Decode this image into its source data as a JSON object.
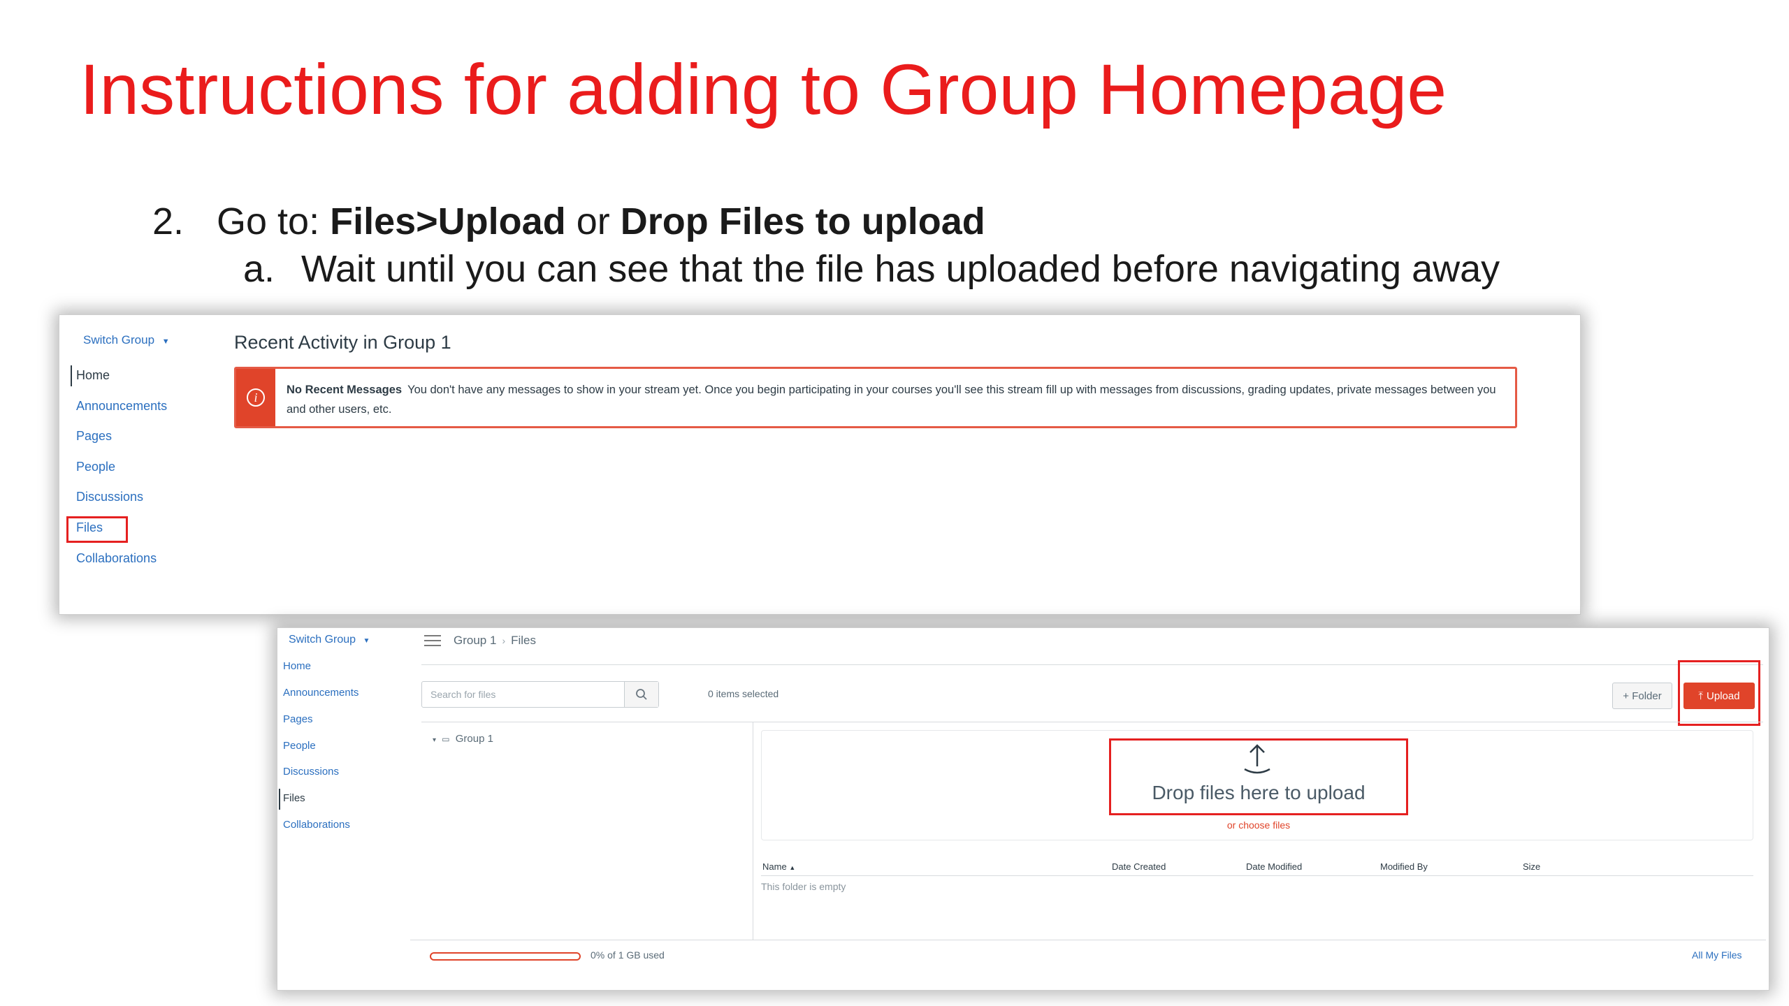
{
  "slide": {
    "title": "Instructions for adding to Group Homepage",
    "step": {
      "number": "2.",
      "prefix": "Go to: ",
      "bold1": "Files>Upload",
      "middle": " or ",
      "bold2": "Drop Files to upload"
    },
    "substep": {
      "number": "a.",
      "text": "Wait until you can see that the file has uploaded before navigating away"
    }
  },
  "screenshot1": {
    "switch_group": "Switch Group",
    "nav": [
      "Home",
      "Announcements",
      "Pages",
      "People",
      "Discussions",
      "Files",
      "Collaborations"
    ],
    "active_nav": "Home",
    "highlighted_nav": "Files",
    "recent_title": "Recent Activity in Group 1",
    "alert": {
      "heading": "No Recent Messages",
      "body": "You don't have any messages to show in your stream yet. Once you begin participating in your courses you'll see this stream fill up with messages from discussions, grading updates, private messages between you and other users, etc."
    }
  },
  "screenshot2": {
    "switch_group": "Switch Group",
    "nav": [
      "Home",
      "Announcements",
      "Pages",
      "People",
      "Discussions",
      "Files",
      "Collaborations"
    ],
    "active_nav": "Files",
    "breadcrumb": [
      "Group 1",
      "Files"
    ],
    "search_placeholder": "Search for files",
    "items_selected": "0 items selected",
    "folder_button": "+ Folder",
    "upload_button": "Upload",
    "tree_root": "Group 1",
    "drop_text": "Drop files here to upload",
    "choose_files": "or choose files",
    "columns": [
      "Name",
      "Date Created",
      "Date Modified",
      "Modified By",
      "Size"
    ],
    "empty_text": "This folder is empty",
    "quota_text": "0% of 1 GB used",
    "quota_fraction": 0,
    "all_files_link": "All My Files"
  },
  "colors": {
    "title_red": "#ea1c1c",
    "canvas_link_blue": "#2b6fbf",
    "canvas_orange": "#e0442a",
    "highlight_red": "#e52020"
  },
  "icons": [
    "info-icon",
    "caret-down-icon",
    "hamburger-icon",
    "search-icon",
    "upload-arrow-icon",
    "folder-icon",
    "caret-right-icon",
    "sort-up-icon"
  ]
}
